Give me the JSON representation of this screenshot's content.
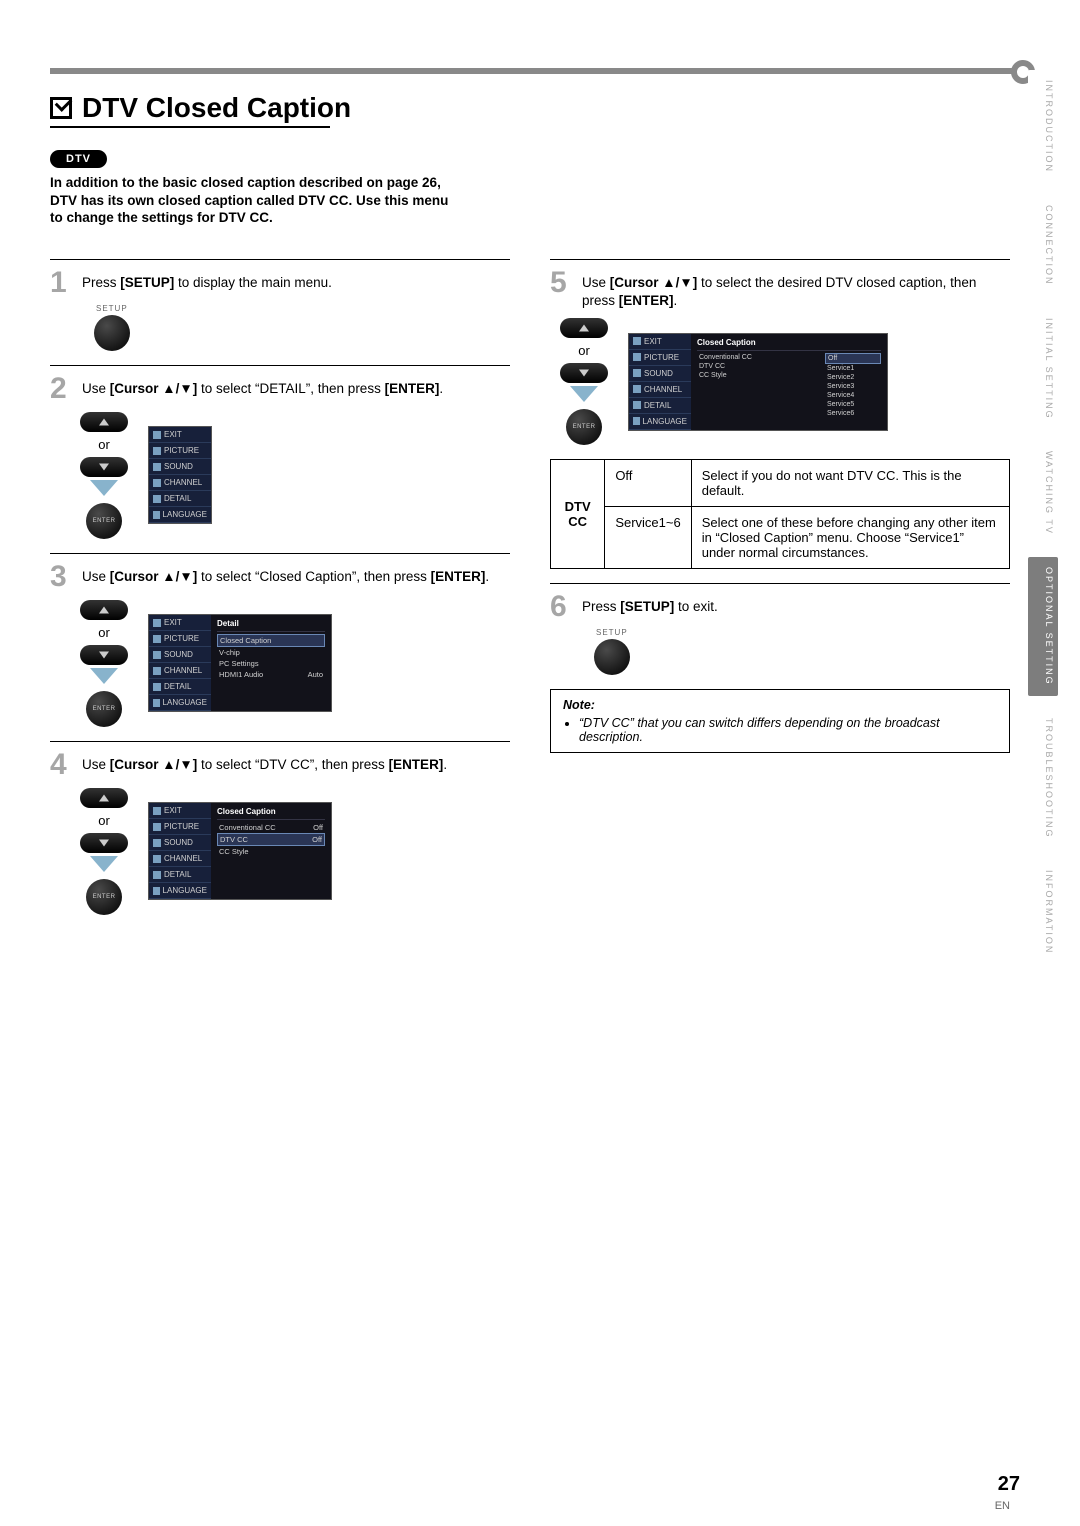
{
  "title": "DTV Closed Caption",
  "dtv_pill": "DTV",
  "intro": "In addition to the basic closed caption described on page 26, DTV has its own closed caption called DTV CC. Use this menu to change the settings for DTV CC.",
  "side_tabs": [
    {
      "label": "INTRODUCTION",
      "active": false
    },
    {
      "label": "CONNECTION",
      "active": false
    },
    {
      "label": "INITIAL SETTING",
      "active": false
    },
    {
      "label": "WATCHING TV",
      "active": false
    },
    {
      "label": "OPTIONAL SETTING",
      "active": true
    },
    {
      "label": "TROUBLESHOOTING",
      "active": false
    },
    {
      "label": "INFORMATION",
      "active": false
    }
  ],
  "steps": {
    "s1": {
      "text_a": "Press ",
      "bold_a": "[SETUP]",
      "text_b": " to display the main menu."
    },
    "s2": {
      "text_a": "Use ",
      "bold_a": "[Cursor ▲/▼]",
      "text_b": " to select “DETAIL”, then press ",
      "bold_b": "[ENTER]",
      "text_c": "."
    },
    "s3": {
      "text_a": "Use ",
      "bold_a": "[Cursor ▲/▼]",
      "text_b": " to select “Closed Caption”, then press ",
      "bold_b": "[ENTER]",
      "text_c": "."
    },
    "s4": {
      "text_a": "Use ",
      "bold_a": "[Cursor ▲/▼]",
      "text_b": " to select “DTV CC”, then press ",
      "bold_b": "[ENTER]",
      "text_c": "."
    },
    "s5": {
      "text_a": "Use ",
      "bold_a": "[Cursor ▲/▼]",
      "text_b": " to select the desired DTV closed caption, then press ",
      "bold_b": "[ENTER]",
      "text_c": "."
    },
    "s6": {
      "text_a": "Press ",
      "bold_a": "[SETUP]",
      "text_b": " to exit."
    }
  },
  "setup_label": "SETUP",
  "enter_label": "ENTER",
  "or_label": "or",
  "osd_side_items": [
    "EXIT",
    "PICTURE",
    "SOUND",
    "CHANNEL",
    "DETAIL",
    "LANGUAGE"
  ],
  "osd3": {
    "title": "Detail",
    "items": [
      {
        "l": "Closed Caption",
        "r": "",
        "hl": true
      },
      {
        "l": "V-chip",
        "r": ""
      },
      {
        "l": "PC Settings",
        "r": ""
      },
      {
        "l": "HDMI1 Audio",
        "r": "Auto"
      }
    ]
  },
  "osd4": {
    "title": "Closed Caption",
    "items": [
      {
        "l": "Conventional CC",
        "r": "Off"
      },
      {
        "l": "DTV CC",
        "r": "Off",
        "hl": true
      },
      {
        "l": "CC Style",
        "r": ""
      }
    ]
  },
  "osd5": {
    "title": "Closed Caption",
    "left_items": [
      {
        "l": "Conventional CC",
        "r": ""
      },
      {
        "l": "DTV CC",
        "r": ""
      },
      {
        "l": "CC Style",
        "r": ""
      }
    ],
    "right_items": [
      "Off",
      "Service1",
      "Service2",
      "Service3",
      "Service4",
      "Service5",
      "Service6"
    ]
  },
  "table": {
    "header": "DTV CC",
    "rows": [
      {
        "opt": "Off",
        "desc": "Select if you do not want DTV CC. This is the default."
      },
      {
        "opt": "Service1~6",
        "desc": "Select one of these before changing any other item in “Closed Caption” menu. Choose “Service1” under normal circumstances."
      }
    ]
  },
  "note": {
    "title": "Note:",
    "items": [
      "“DTV CC” that you can switch differs depending on the broadcast description."
    ]
  },
  "page_number": "27",
  "page_lang": "EN"
}
